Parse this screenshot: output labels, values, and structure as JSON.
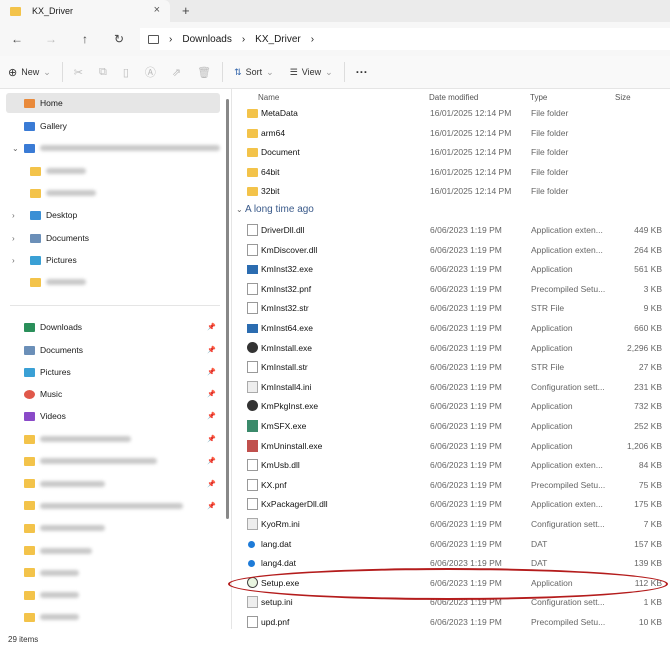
{
  "tab": {
    "title": "KX_Driver",
    "close": "×",
    "new_tab": "+"
  },
  "nav": {
    "back": "←",
    "forward": "→",
    "up": "↑",
    "refresh": "↻",
    "breadcrumb": [
      "Downloads",
      "KX_Driver"
    ]
  },
  "toolbar": {
    "new": "New",
    "sort": "Sort",
    "view": "View",
    "more": "···"
  },
  "sidebar": {
    "top": [
      {
        "label": "Home",
        "selected": true
      },
      {
        "label": "Gallery"
      }
    ],
    "tree": [
      {
        "label": "Desktop"
      },
      {
        "label": "Documents"
      },
      {
        "label": "Pictures"
      }
    ],
    "quick": [
      {
        "label": "Downloads"
      },
      {
        "label": "Documents"
      },
      {
        "label": "Pictures"
      },
      {
        "label": "Music"
      },
      {
        "label": "Videos"
      }
    ]
  },
  "columns": {
    "name": "Name",
    "date": "Date modified",
    "type": "Type",
    "size": "Size"
  },
  "group": "A long time ago",
  "folders": [
    {
      "name": "MetaData",
      "date": "16/01/2025 12:14 PM",
      "type": "File folder",
      "size": ""
    },
    {
      "name": "arm64",
      "date": "16/01/2025 12:14 PM",
      "type": "File folder",
      "size": ""
    },
    {
      "name": "Document",
      "date": "16/01/2025 12:14 PM",
      "type": "File folder",
      "size": ""
    },
    {
      "name": "64bit",
      "date": "16/01/2025 12:14 PM",
      "type": "File folder",
      "size": ""
    },
    {
      "name": "32bit",
      "date": "16/01/2025 12:14 PM",
      "type": "File folder",
      "size": ""
    }
  ],
  "files": [
    {
      "name": "DriverDll.dll",
      "date": "6/06/2023 1:19 PM",
      "type": "Application exten...",
      "size": "449 KB",
      "icon": "dll"
    },
    {
      "name": "KmDiscover.dll",
      "date": "6/06/2023 1:19 PM",
      "type": "Application exten...",
      "size": "264 KB",
      "icon": "dll"
    },
    {
      "name": "KmInst32.exe",
      "date": "6/06/2023 1:19 PM",
      "type": "Application",
      "size": "561 KB",
      "icon": "exe"
    },
    {
      "name": "KmInst32.pnf",
      "date": "6/06/2023 1:19 PM",
      "type": "Precompiled Setu...",
      "size": "3 KB",
      "icon": "dll"
    },
    {
      "name": "KmInst32.str",
      "date": "6/06/2023 1:19 PM",
      "type": "STR File",
      "size": "9 KB",
      "icon": "file"
    },
    {
      "name": "KmInst64.exe",
      "date": "6/06/2023 1:19 PM",
      "type": "Application",
      "size": "660 KB",
      "icon": "exe"
    },
    {
      "name": "KmInstall.exe",
      "date": "6/06/2023 1:19 PM",
      "type": "Application",
      "size": "2,296 KB",
      "icon": "globe"
    },
    {
      "name": "KmInstall.str",
      "date": "6/06/2023 1:19 PM",
      "type": "STR File",
      "size": "27 KB",
      "icon": "file"
    },
    {
      "name": "KmInstall4.ini",
      "date": "6/06/2023 1:19 PM",
      "type": "Configuration sett...",
      "size": "231 KB",
      "icon": "ini"
    },
    {
      "name": "KmPkgInst.exe",
      "date": "6/06/2023 1:19 PM",
      "type": "Application",
      "size": "732 KB",
      "icon": "globe"
    },
    {
      "name": "KmSFX.exe",
      "date": "6/06/2023 1:19 PM",
      "type": "Application",
      "size": "252 KB",
      "icon": "sfx"
    },
    {
      "name": "KmUninstall.exe",
      "date": "6/06/2023 1:19 PM",
      "type": "Application",
      "size": "1,206 KB",
      "icon": "uninst"
    },
    {
      "name": "KmUsb.dll",
      "date": "6/06/2023 1:19 PM",
      "type": "Application exten...",
      "size": "84 KB",
      "icon": "dll"
    },
    {
      "name": "KX.pnf",
      "date": "6/06/2023 1:19 PM",
      "type": "Precompiled Setu...",
      "size": "75 KB",
      "icon": "dll"
    },
    {
      "name": "KxPackagerDll.dll",
      "date": "6/06/2023 1:19 PM",
      "type": "Application exten...",
      "size": "175 KB",
      "icon": "dll"
    },
    {
      "name": "KyoRm.ini",
      "date": "6/06/2023 1:19 PM",
      "type": "Configuration sett...",
      "size": "7 KB",
      "icon": "ini"
    },
    {
      "name": "lang.dat",
      "date": "6/06/2023 1:19 PM",
      "type": "DAT",
      "size": "157 KB",
      "icon": "dat"
    },
    {
      "name": "lang4.dat",
      "date": "6/06/2023 1:19 PM",
      "type": "DAT",
      "size": "139 KB",
      "icon": "dat"
    },
    {
      "name": "Setup.exe",
      "date": "6/06/2023 1:19 PM",
      "type": "Application",
      "size": "112 KB",
      "icon": "setup",
      "highlighted": true
    },
    {
      "name": "setup.ini",
      "date": "6/06/2023 1:19 PM",
      "type": "Configuration sett...",
      "size": "1 KB",
      "icon": "ini"
    },
    {
      "name": "upd.pnf",
      "date": "6/06/2023 1:19 PM",
      "type": "Precompiled Setu...",
      "size": "10 KB",
      "icon": "dll"
    }
  ],
  "status": {
    "count": "29 items"
  },
  "colors": {
    "folder": "#f3c34a",
    "highlight": "#b41c1c",
    "selected": "#e6e6e6"
  }
}
